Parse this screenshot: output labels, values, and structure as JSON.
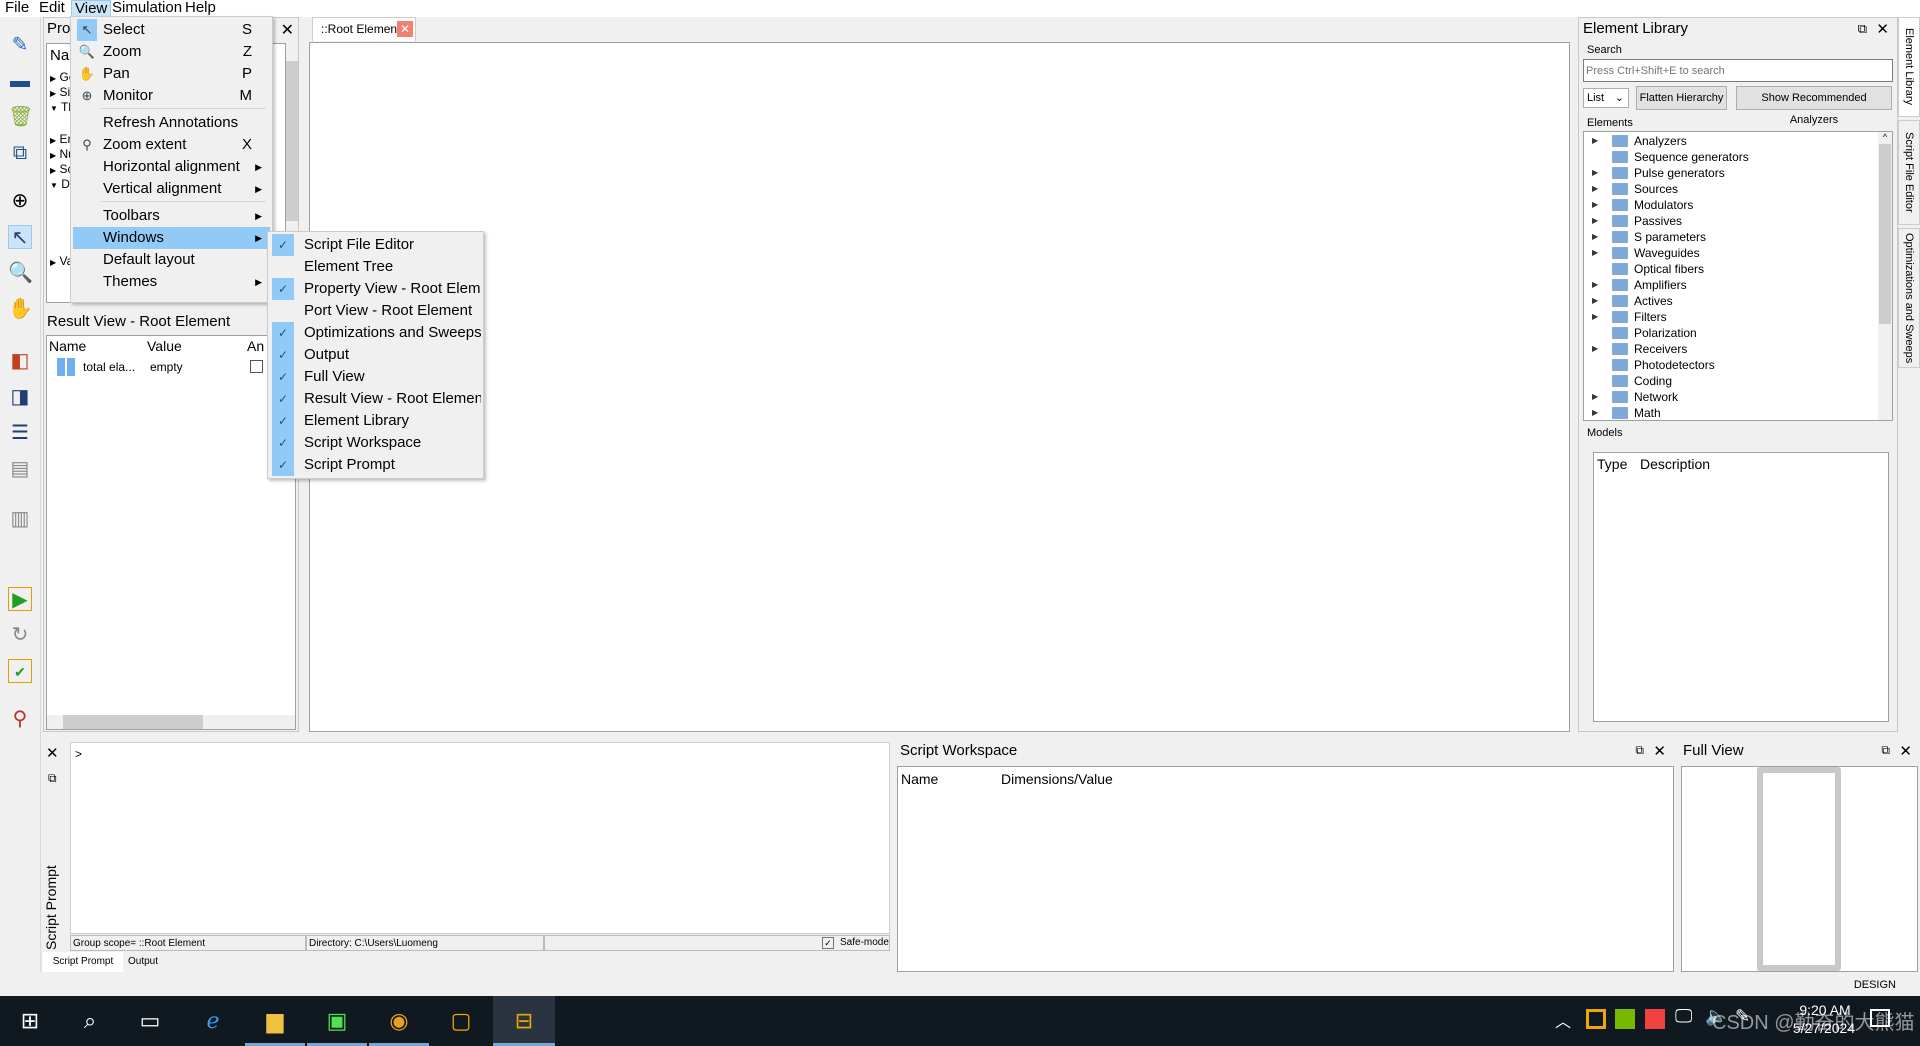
{
  "menubar": {
    "items": [
      "File",
      "Edit",
      "View",
      "Simulation",
      "Help"
    ]
  },
  "property_panel": {
    "title": "Pro",
    "col": "Nar",
    "rows": [
      "Ge",
      "Sir",
      "Th",
      "En",
      "Nu",
      "Sc",
      "De",
      "Va"
    ]
  },
  "result_view": {
    "title": "Result View - Root Element",
    "columns": [
      "Name",
      "Value",
      "An"
    ],
    "rows": [
      {
        "name": "total ela...",
        "value": "empty"
      }
    ]
  },
  "canvas": {
    "tab": "::Root Element"
  },
  "view_menu": {
    "items": [
      {
        "label": "Select",
        "shortcut": "S",
        "icon": "arrow-pointer-icon"
      },
      {
        "label": "Zoom",
        "shortcut": "Z",
        "icon": "magnifier-icon"
      },
      {
        "label": "Pan",
        "shortcut": "P",
        "icon": "hand-icon"
      },
      {
        "label": "Monitor",
        "shortcut": "M",
        "icon": "crosshair-icon"
      },
      {
        "label": "Refresh Annotations",
        "shortcut": ""
      },
      {
        "label": "Zoom extent",
        "shortcut": "X",
        "icon": "zoom-extent-icon"
      },
      {
        "label": "Horizontal alignment",
        "submenu": true
      },
      {
        "label": "Vertical alignment",
        "submenu": true
      },
      {
        "label": "Toolbars",
        "submenu": true
      },
      {
        "label": "Windows",
        "submenu": true,
        "highlighted": true
      },
      {
        "label": "Default layout"
      },
      {
        "label": "Themes",
        "submenu": true
      }
    ]
  },
  "windows_menu": {
    "items": [
      {
        "label": "Script File Editor",
        "checked": true
      },
      {
        "label": "Element Tree",
        "checked": false
      },
      {
        "label": "Property View - Root Eleme",
        "checked": true
      },
      {
        "label": "Port View - Root Element",
        "checked": false
      },
      {
        "label": "Optimizations and Sweeps",
        "checked": true
      },
      {
        "label": "Output",
        "checked": true
      },
      {
        "label": "Full View",
        "checked": true
      },
      {
        "label": "Result View - Root Element",
        "checked": true
      },
      {
        "label": "Element Library",
        "checked": true
      },
      {
        "label": "Script Workspace",
        "checked": true
      },
      {
        "label": "Script Prompt",
        "checked": true
      }
    ]
  },
  "element_library": {
    "title": "Element Library",
    "search_label": "Search",
    "search_placeholder": "Press Ctrl+Shift+E to search",
    "view_select": "List",
    "flatten_btn": "Flatten Hierarchy",
    "recommend_btn": "Show Recommended Analyzers",
    "elements_label": "Elements",
    "elements": [
      {
        "label": "Analyzers",
        "expandable": true
      },
      {
        "label": "Sequence generators",
        "expandable": false
      },
      {
        "label": "Pulse generators",
        "expandable": true
      },
      {
        "label": "Sources",
        "expandable": true
      },
      {
        "label": "Modulators",
        "expandable": true
      },
      {
        "label": "Passives",
        "expandable": true
      },
      {
        "label": "S parameters",
        "expandable": true
      },
      {
        "label": "Waveguides",
        "expandable": true
      },
      {
        "label": "Optical fibers",
        "expandable": false
      },
      {
        "label": "Amplifiers",
        "expandable": true
      },
      {
        "label": "Actives",
        "expandable": true
      },
      {
        "label": "Filters",
        "expandable": true
      },
      {
        "label": "Polarization",
        "expandable": false
      },
      {
        "label": "Receivers",
        "expandable": true
      },
      {
        "label": "Photodetectors",
        "expandable": false
      },
      {
        "label": "Coding",
        "expandable": false
      },
      {
        "label": "Network",
        "expandable": true
      },
      {
        "label": "Math",
        "expandable": true
      }
    ],
    "models_label": "Models",
    "models_columns": [
      "Type",
      "Description"
    ]
  },
  "side_tabs": [
    "Element Library",
    "Script File Editor",
    "Optimizations and Sweeps"
  ],
  "script_prompt": {
    "title": "Script Prompt",
    "prompt": ">",
    "group_scope": "Group scope= ::Root Element",
    "directory": "Directory: C:\\Users\\Luomeng",
    "safe_mode": "Safe-mode",
    "safe_mode_checked": true,
    "tabs": [
      "Script Prompt",
      "Output"
    ]
  },
  "script_workspace": {
    "title": "Script Workspace",
    "columns": [
      "Name",
      "Dimensions/Value"
    ]
  },
  "full_view": {
    "title": "Full View"
  },
  "status": {
    "mode": "DESIGN"
  },
  "taskbar": {
    "time": "9:20 AM",
    "date": "5/27/2024",
    "watermark": "CSDN @勤奋的大熊猫"
  },
  "colors": {
    "menu_highlight": "#91c9f7",
    "taskbar": "#101820",
    "close_tab": "#f08070"
  }
}
